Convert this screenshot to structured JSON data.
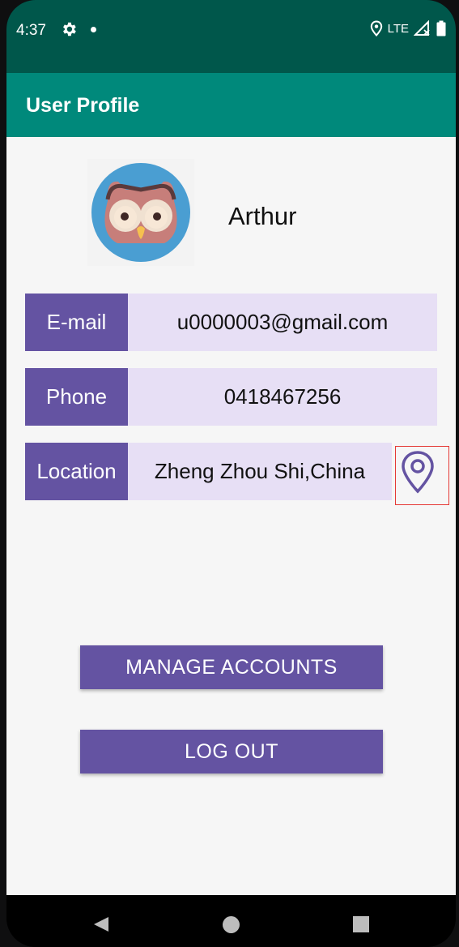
{
  "status_bar": {
    "time": "4:37",
    "network": "LTE"
  },
  "app_bar": {
    "title": "User Profile"
  },
  "profile": {
    "name": "Arthur"
  },
  "fields": {
    "email": {
      "label": "E-mail",
      "value": "u0000003@gmail.com"
    },
    "phone": {
      "label": "Phone",
      "value": "0418467256"
    },
    "location": {
      "label": "Location",
      "value": "Zheng Zhou Shi,China"
    }
  },
  "buttons": {
    "manage_accounts": "MANAGE ACCOUNTS",
    "log_out": "LOG OUT"
  },
  "colors": {
    "status_bar": "#00574b",
    "app_bar": "#00897b",
    "accent_purple": "#6453a2",
    "value_background": "#e7dff5"
  },
  "icons": {
    "settings": "gear-icon",
    "location_status": "location-pin-icon",
    "signal": "signal-icon",
    "battery": "battery-icon",
    "avatar": "owl-avatar",
    "location_action": "map-pin-icon",
    "nav_back": "back-triangle-icon",
    "nav_home": "home-circle-icon",
    "nav_recent": "recent-square-icon"
  }
}
